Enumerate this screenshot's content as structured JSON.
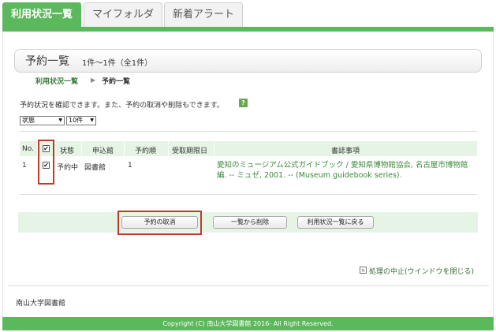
{
  "tabs": [
    {
      "label": "利用状況一覧"
    },
    {
      "label": "マイフォルダ"
    },
    {
      "label": "新着アラート"
    }
  ],
  "page": {
    "title": "予約一覧",
    "count": "1件～1件（全1件）",
    "breadcrumb": {
      "link": "利用状況一覧",
      "separator": "▶",
      "current": "予約一覧"
    },
    "description": "予約状況を確認できます。また、予約の取消や削除もできます。",
    "help_label": "?"
  },
  "controls": {
    "status_select": "状態",
    "count_select": "10件"
  },
  "table": {
    "headers": {
      "no": "No.",
      "status": "状態",
      "branch": "申込館",
      "order": "予約順",
      "deadline": "受取期限日",
      "bib": "書誌事項"
    },
    "rows": [
      {
        "no": "1",
        "status": "予約中",
        "branch": "図書館",
        "order": "1",
        "deadline": "",
        "bib": "愛知のミュージアム公式ガイドブック / 愛知県博物館協会, 名古屋市博物館編. -- ミュゼ, 2001. -- (Museum guidebook series)."
      }
    ]
  },
  "buttons": {
    "cancel": "予約の取消",
    "delete": "一覧から削除",
    "back": "利用状況一覧に戻る"
  },
  "close_link": "処理の中止(ウインドウを閉じる)",
  "footer": {
    "library_name": "南山大学図書館",
    "copyright": "Copyright (C) 南山大学図書館 2016- All Right Reserved."
  },
  "colors": {
    "accent": "#5cb85c",
    "link": "#3a8a3a",
    "highlight": "#c0392b"
  },
  "icons": {
    "check": "checkmark-icon",
    "help": "help-icon",
    "close": "close-box-icon"
  }
}
